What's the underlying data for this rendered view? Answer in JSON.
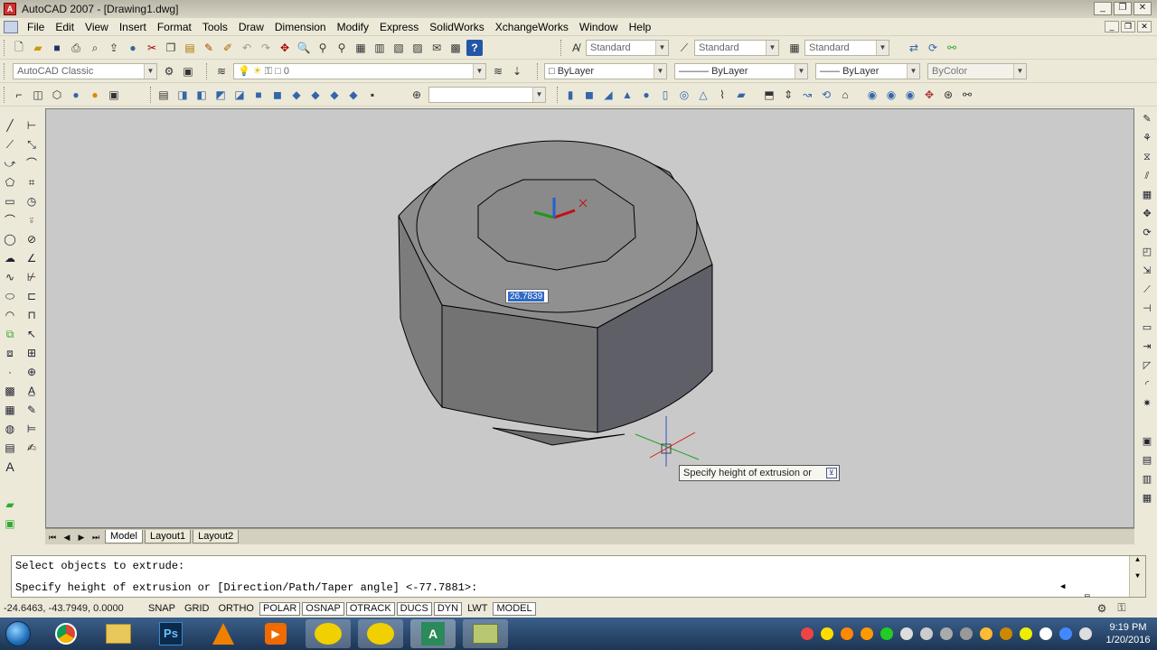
{
  "window": {
    "title": "AutoCAD 2007 - [Drawing1.dwg]",
    "controls": [
      "_",
      "❐",
      "✕"
    ],
    "mdi_controls": [
      "_",
      "❐",
      "✕"
    ]
  },
  "menu": {
    "items": [
      "File",
      "Edit",
      "View",
      "Insert",
      "Format",
      "Tools",
      "Draw",
      "Dimension",
      "Modify",
      "Express",
      "SolidWorks",
      "XchangeWorks",
      "Window",
      "Help"
    ]
  },
  "toolbar1": {
    "text_style": "Standard",
    "dim_style": "Standard",
    "table_style": "Standard"
  },
  "toolbar2": {
    "workspace": "AutoCAD Classic",
    "layer": "0",
    "color": "ByLayer",
    "linetype": "ByLayer",
    "lineweight": "ByLayer",
    "plot_style": "ByColor"
  },
  "toolbar3": {
    "view_combo": ""
  },
  "canvas": {
    "dynamic_input_value": "26.7839",
    "tooltip_text": "Specify height of extrusion or",
    "tooltip_dropdown": "⊻"
  },
  "tabs": {
    "nav": [
      "⏮",
      "◀",
      "▶",
      "⏭"
    ],
    "items": [
      "Model",
      "Layout1",
      "Layout2"
    ],
    "active": "Model"
  },
  "command_line": {
    "line1": "Select objects to extrude:",
    "line2": "Specify height of extrusion or [Direction/Path/Taper angle] <-77.7881>:"
  },
  "status": {
    "coordinates": "-24.6463, -43.7949, 0.0000",
    "buttons": [
      "SNAP",
      "GRID",
      "ORTHO",
      "POLAR",
      "OSNAP",
      "OTRACK",
      "DUCS",
      "DYN",
      "LWT",
      "MODEL"
    ],
    "on_buttons": [
      "POLAR",
      "OSNAP",
      "OTRACK",
      "DUCS",
      "DYN",
      "MODEL"
    ]
  },
  "taskbar": {
    "apps": [
      "Chrome",
      "Explorer",
      "Ps",
      "VLC",
      "Media",
      "Paper",
      "Paper",
      "AutoCAD",
      "Folder"
    ],
    "time": "9:19 PM",
    "date": "1/20/2016"
  },
  "colors": {
    "canvas_bg": "#c9c9c9",
    "solid_top": "#8e8e8e",
    "solid_side_light": "#7d7d7d",
    "solid_side_dark": "#5e5e66",
    "highlight": "#316ac5"
  }
}
